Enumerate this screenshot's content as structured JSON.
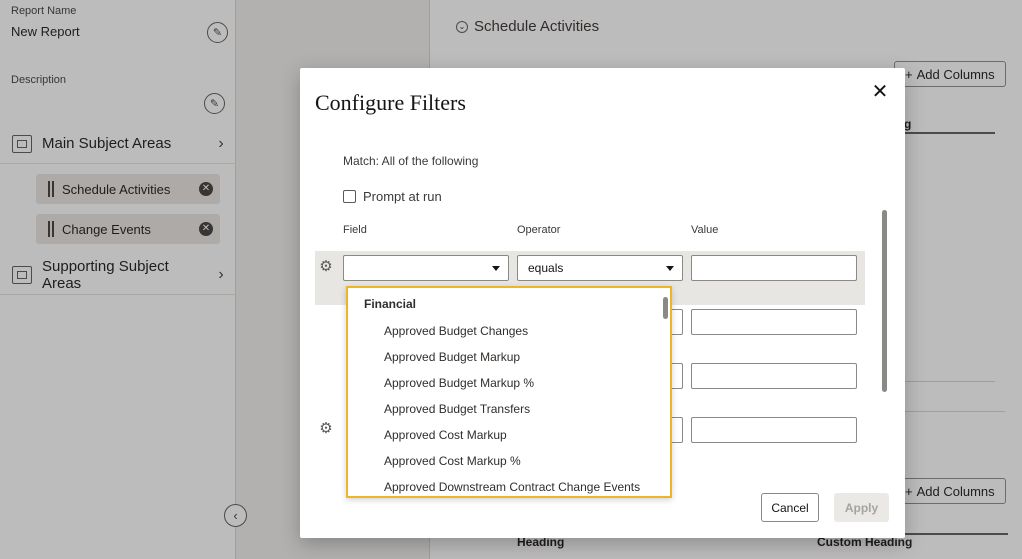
{
  "left_panel": {
    "report_name_label": "Report Name",
    "report_name_value": "New Report",
    "description_label": "Description",
    "main_subject_areas": "Main Subject Areas",
    "chips": [
      {
        "label": "Schedule Activities"
      },
      {
        "label": "Change Events"
      }
    ],
    "supporting_subject_areas": "Supporting Subject Areas"
  },
  "right_panel": {
    "section_title": "Schedule Activities",
    "add_columns_label": "Add Columns",
    "heading_col": "Heading",
    "custom_heading_col": "Custom Heading",
    "partial_heading": "g"
  },
  "dialog": {
    "title": "Configure Filters",
    "close_glyph": "✕",
    "match_text": "Match: All of the following",
    "prompt_label": "Prompt at run",
    "prompt_checked": false,
    "columns": {
      "field": "Field",
      "operator": "Operator",
      "value": "Value"
    },
    "operator_value": "equals",
    "cancel_label": "Cancel",
    "apply_label": "Apply"
  },
  "dropdown": {
    "group": "Financial",
    "items": [
      "Approved Budget Changes",
      "Approved Budget Markup",
      "Approved Budget Markup %",
      "Approved Budget Transfers",
      "Approved Cost Markup",
      "Approved Cost Markup %",
      "Approved Downstream Contract Change Events"
    ]
  },
  "icons": {
    "edit": "pencil-icon",
    "folder": "folder-icon",
    "chevron": "›",
    "gear": "⚙",
    "collapse": "‹",
    "chip_remove": "✕"
  },
  "colors": {
    "accent_focus": "#f0b428",
    "overlay": "rgba(50,48,46,0.32)"
  }
}
